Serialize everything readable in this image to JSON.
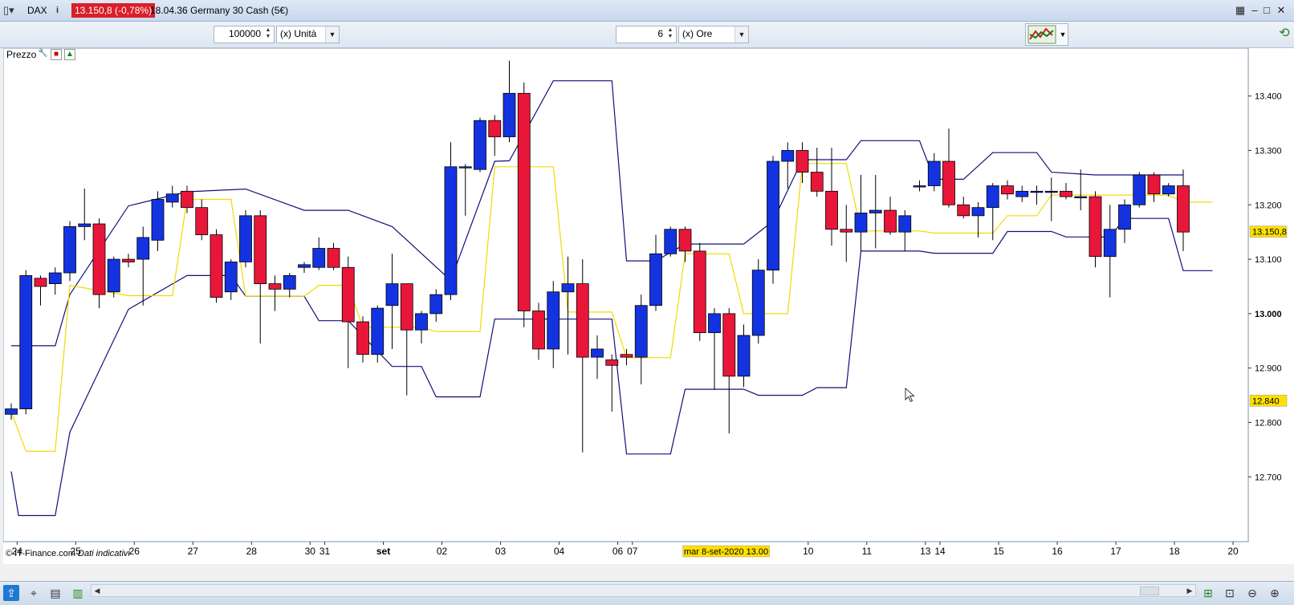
{
  "window": {
    "instrument": "DAX",
    "price_badge": "13.150,8 (-0,78%)",
    "time_and_name": "18.04.36 Germany 30 Cash (5€)",
    "menu_icon": "grid-menu-icon",
    "info_icon": "info-icon"
  },
  "toolbar": {
    "quantity_value": "100000",
    "quantity_unit": "(x) Unità",
    "period_value": "6",
    "period_unit": "(x) Ore"
  },
  "panel": {
    "label": "Prezzo"
  },
  "footer": {
    "copyright": "© IT-Finance.com",
    "note": "Dati indicativi"
  },
  "colors": {
    "up": "#1433e0",
    "down": "#e8173a",
    "band": "#10107a",
    "mid": "#f5d800",
    "badge_red": "#d91f2a",
    "yellow_label": "#ffe000"
  },
  "chart_data": {
    "type": "candlestick",
    "y_axis": {
      "ticks": [
        12700,
        12800,
        12900,
        13000,
        13100,
        13200,
        13300,
        13400
      ],
      "tick_labels": [
        "12.700",
        "12.800",
        "12.900",
        "13.000",
        "13.100",
        "13.200",
        "13.300",
        "13.400"
      ],
      "ylim": [
        12581,
        13488
      ],
      "side": "right"
    },
    "x_axis": {
      "tick_labels": [
        "24",
        "25",
        "26",
        "27",
        "28",
        "30",
        "31",
        "set",
        "02",
        "03",
        "04",
        "06",
        "07",
        "10",
        "11",
        "13",
        "14",
        "15",
        "16",
        "17",
        "18",
        "20"
      ],
      "tick_positions": [
        0.4,
        4.4,
        8.4,
        12.4,
        16.4,
        20.4,
        21.4,
        25.4,
        29.4,
        33.4,
        37.4,
        41.4,
        42.4,
        54.4,
        58.4,
        62.4,
        63.4,
        67.4,
        71.4,
        75.4,
        79.4,
        83.4
      ],
      "bold_labels": [
        "set"
      ],
      "cursor_label": "mar 8-set-2020 13.00",
      "cursor_position": 48.8
    },
    "price_labels": [
      {
        "value": 13150.8,
        "text": "13.150,8",
        "color": "#ffe000"
      },
      {
        "value": 12840,
        "text": "12.840",
        "color": "#ffe000"
      }
    ],
    "candles": [
      [
        12815,
        12825,
        12805,
        12835
      ],
      [
        12825,
        13070,
        12815,
        13080
      ],
      [
        13065,
        13050,
        13015,
        13070
      ],
      [
        13055,
        13075,
        13035,
        13085
      ],
      [
        13075,
        13160,
        13060,
        13170
      ],
      [
        13160,
        13165,
        13135,
        13230
      ],
      [
        13165,
        13035,
        13010,
        13175
      ],
      [
        13040,
        13100,
        13030,
        13105
      ],
      [
        13100,
        13095,
        13085,
        13110
      ],
      [
        13100,
        13140,
        13015,
        13160
      ],
      [
        13135,
        13210,
        13115,
        13225
      ],
      [
        13205,
        13220,
        13195,
        13235
      ],
      [
        13225,
        13195,
        13185,
        13235
      ],
      [
        13195,
        13145,
        13135,
        13210
      ],
      [
        13145,
        13030,
        13020,
        13155
      ],
      [
        13040,
        13095,
        13025,
        13100
      ],
      [
        13095,
        13180,
        13085,
        13190
      ],
      [
        13180,
        13055,
        12945,
        13190
      ],
      [
        13055,
        13045,
        13005,
        13070
      ],
      [
        13045,
        13070,
        13030,
        13075
      ],
      [
        13085,
        13090,
        13075,
        13095
      ],
      [
        13085,
        13120,
        13080,
        13140
      ],
      [
        13120,
        13085,
        13080,
        13130
      ],
      [
        13085,
        12985,
        12900,
        13105
      ],
      [
        12985,
        12925,
        12910,
        12995
      ],
      [
        12925,
        13010,
        12910,
        13015
      ],
      [
        13015,
        13055,
        12935,
        13110
      ],
      [
        13055,
        12970,
        12850,
        13055
      ],
      [
        12970,
        13000,
        12945,
        13005
      ],
      [
        13000,
        13035,
        12985,
        13045
      ],
      [
        13035,
        13270,
        13025,
        13315
      ],
      [
        13270,
        13270,
        13180,
        13275
      ],
      [
        13265,
        13355,
        13260,
        13360
      ],
      [
        13355,
        13325,
        13290,
        13365
      ],
      [
        13325,
        13405,
        13315,
        13465
      ],
      [
        13405,
        13005,
        12975,
        13425
      ],
      [
        13005,
        12935,
        12915,
        13020
      ],
      [
        12935,
        13040,
        12900,
        13060
      ],
      [
        13040,
        13055,
        12925,
        13105
      ],
      [
        13055,
        12920,
        12745,
        13100
      ],
      [
        12920,
        12935,
        12880,
        12960
      ],
      [
        12915,
        12905,
        12820,
        12925
      ],
      [
        12925,
        12920,
        12905,
        12935
      ],
      [
        12920,
        13015,
        12870,
        13035
      ],
      [
        13015,
        13110,
        13005,
        13145
      ],
      [
        13110,
        13155,
        13105,
        13160
      ],
      [
        13155,
        13115,
        13095,
        13160
      ],
      [
        13115,
        12965,
        12950,
        13130
      ],
      [
        12965,
        13000,
        12860,
        13010
      ],
      [
        13000,
        12885,
        12780,
        13010
      ],
      [
        12885,
        12960,
        12865,
        12980
      ],
      [
        12960,
        13080,
        12945,
        13100
      ],
      [
        13080,
        13280,
        13055,
        13290
      ],
      [
        13280,
        13300,
        13230,
        13315
      ],
      [
        13300,
        13260,
        13240,
        13315
      ],
      [
        13260,
        13225,
        13215,
        13305
      ],
      [
        13225,
        13155,
        13125,
        13305
      ],
      [
        13155,
        13150,
        13095,
        13200
      ],
      [
        13150,
        13185,
        13115,
        13255
      ],
      [
        13185,
        13190,
        13120,
        13255
      ],
      [
        13190,
        13150,
        13145,
        13215
      ],
      [
        13150,
        13180,
        13115,
        13190
      ],
      [
        13235,
        13235,
        13225,
        13245
      ],
      [
        13235,
        13280,
        13225,
        13295
      ],
      [
        13280,
        13200,
        13195,
        13340
      ],
      [
        13200,
        13180,
        13175,
        13215
      ],
      [
        13180,
        13195,
        13140,
        13205
      ],
      [
        13195,
        13235,
        13135,
        13240
      ],
      [
        13235,
        13220,
        13210,
        13245
      ],
      [
        13215,
        13225,
        13205,
        13235
      ],
      [
        13225,
        13225,
        13200,
        13235
      ],
      [
        13225,
        13225,
        13170,
        13250
      ],
      [
        13225,
        13215,
        13210,
        13240
      ],
      [
        13215,
        13215,
        13190,
        13265
      ],
      [
        13215,
        13105,
        13085,
        13225
      ],
      [
        13105,
        13155,
        13030,
        13200
      ],
      [
        13155,
        13200,
        13130,
        13210
      ],
      [
        13200,
        13255,
        13195,
        13260
      ],
      [
        13255,
        13220,
        13205,
        13260
      ],
      [
        13220,
        13235,
        13215,
        13240
      ],
      [
        13235,
        13150,
        13115,
        13265
      ]
    ],
    "series": [
      {
        "role": "upper-band",
        "color": "#10107a",
        "points": [
          [
            0,
            12941
          ],
          [
            3,
            12941
          ],
          [
            4,
            13035
          ],
          [
            8,
            13198
          ],
          [
            12,
            13224
          ],
          [
            16,
            13229
          ],
          [
            20,
            13190
          ],
          [
            23,
            13190
          ],
          [
            26,
            13160
          ],
          [
            30,
            13061
          ],
          [
            33,
            13280
          ],
          [
            34,
            13281
          ],
          [
            37,
            13428
          ],
          [
            41,
            13428
          ],
          [
            42,
            13097
          ],
          [
            44,
            13097
          ],
          [
            46,
            13128
          ],
          [
            50,
            13128
          ],
          [
            52,
            13170
          ],
          [
            54,
            13283
          ],
          [
            57,
            13283
          ],
          [
            58,
            13318
          ],
          [
            62,
            13318
          ],
          [
            63,
            13247
          ],
          [
            65,
            13247
          ],
          [
            67,
            13296
          ],
          [
            70,
            13296
          ],
          [
            71,
            13260
          ],
          [
            74,
            13255
          ],
          [
            75,
            13255
          ],
          [
            76,
            13255
          ],
          [
            79,
            13255
          ],
          [
            80,
            13255
          ]
        ]
      },
      {
        "role": "lower-band",
        "color": "#10107a",
        "points": [
          [
            0,
            12710
          ],
          [
            0.5,
            12629
          ],
          [
            3,
            12629
          ],
          [
            4,
            12782
          ],
          [
            8,
            13008
          ],
          [
            12,
            13070
          ],
          [
            15,
            13070
          ],
          [
            16,
            13032
          ],
          [
            20,
            13032
          ],
          [
            21,
            12987
          ],
          [
            23,
            12987
          ],
          [
            26,
            12903
          ],
          [
            28,
            12903
          ],
          [
            29,
            12847
          ],
          [
            32,
            12847
          ],
          [
            33,
            12990
          ],
          [
            41,
            12990
          ],
          [
            42,
            12742
          ],
          [
            45,
            12742
          ],
          [
            46,
            12861
          ],
          [
            50,
            12861
          ],
          [
            51,
            12850
          ],
          [
            54,
            12850
          ],
          [
            55,
            12864
          ],
          [
            57,
            12864
          ],
          [
            58,
            13115
          ],
          [
            62,
            13115
          ],
          [
            63,
            13111
          ],
          [
            67,
            13111
          ],
          [
            68,
            13151
          ],
          [
            71,
            13151
          ],
          [
            72,
            13141
          ],
          [
            75,
            13141
          ],
          [
            76,
            13175
          ],
          [
            79,
            13175
          ],
          [
            80,
            13079
          ],
          [
            82,
            13079
          ]
        ]
      },
      {
        "role": "mid-line",
        "color": "#f5d800",
        "points": [
          [
            0,
            12820
          ],
          [
            1,
            12747
          ],
          [
            3,
            12747
          ],
          [
            4,
            13052
          ],
          [
            8,
            13033
          ],
          [
            11,
            13033
          ],
          [
            12,
            13210
          ],
          [
            14,
            13210
          ],
          [
            15,
            13210
          ],
          [
            16,
            13032
          ],
          [
            20,
            13032
          ],
          [
            21,
            13052
          ],
          [
            23,
            13052
          ],
          [
            24,
            12975
          ],
          [
            28,
            12975
          ],
          [
            29,
            12967
          ],
          [
            32,
            12967
          ],
          [
            33,
            13270
          ],
          [
            37,
            13270
          ],
          [
            38,
            13003
          ],
          [
            41,
            13003
          ],
          [
            42,
            12919
          ],
          [
            45,
            12919
          ],
          [
            46,
            13110
          ],
          [
            49,
            13110
          ],
          [
            50,
            13000
          ],
          [
            53,
            13000
          ],
          [
            54,
            13276
          ],
          [
            57,
            13276
          ],
          [
            58,
            13152
          ],
          [
            62,
            13152
          ],
          [
            63,
            13148
          ],
          [
            67,
            13148
          ],
          [
            68,
            13180
          ],
          [
            70,
            13180
          ],
          [
            71,
            13218
          ],
          [
            74,
            13218
          ],
          [
            75,
            13218
          ],
          [
            79,
            13218
          ],
          [
            80,
            13205
          ],
          [
            82,
            13205
          ]
        ]
      }
    ]
  }
}
